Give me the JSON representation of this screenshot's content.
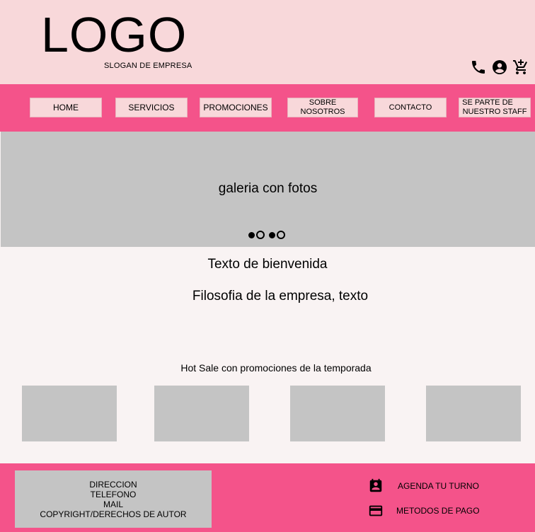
{
  "header": {
    "logo": "LOGO",
    "slogan": "SLOGAN DE EMPRESA",
    "icons": [
      "phone-icon",
      "account-icon",
      "add-to-cart-icon"
    ]
  },
  "nav": {
    "items": [
      {
        "label": "HOME"
      },
      {
        "label": "SERVICIOS"
      },
      {
        "label": "PROMOCIONES"
      },
      {
        "label": "SOBRE NOSOTROS"
      },
      {
        "label": "CONTACTO"
      },
      {
        "label_line1": "SE PARTE DE",
        "label_line2": "NUESTRO STAFF"
      }
    ]
  },
  "gallery": {
    "caption": "galeria con fotos",
    "dots": [
      "filled",
      "ring",
      "filled",
      "ring"
    ]
  },
  "main": {
    "welcome": "Texto de bienvenida",
    "philosophy": "Filosofia de la empresa, texto",
    "hotsale_title": "Hot Sale con promociones de la temporada"
  },
  "footer": {
    "info": [
      "DIRECCION",
      "TELEFONO",
      "MAIL",
      "COPYRIGHT/DERECHOS DE AUTOR"
    ],
    "links": [
      {
        "icon": "calendar-icon",
        "label": "AGENDA TU TURNO"
      },
      {
        "icon": "credit-card-icon",
        "label": "METODOS DE PAGO"
      }
    ]
  },
  "colors": {
    "header_bg": "#f8d8da",
    "nav_bg": "#f4538a",
    "placeholder_gray": "#c4c4c4",
    "page_bg": "#f9f3f3"
  }
}
